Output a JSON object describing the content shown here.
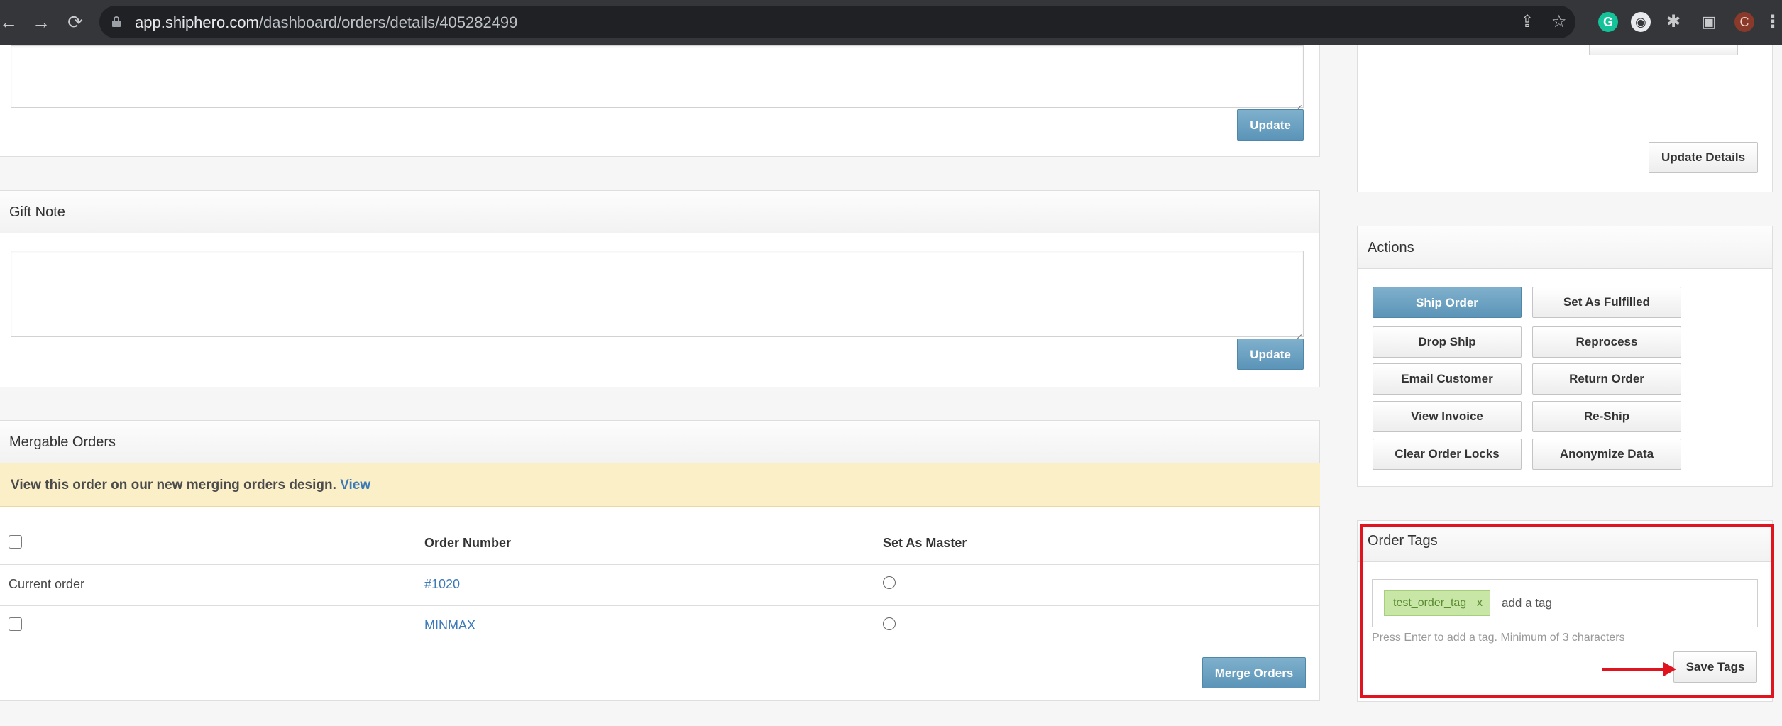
{
  "browser": {
    "url_host": "app.shiphero.com",
    "url_path": "/dashboard/orders/details/405282499",
    "profile_initial": "C",
    "grammarly_initial": "G",
    "accent_color": "#e0141e"
  },
  "notes_panel": {
    "update_label": "Update"
  },
  "gift_note": {
    "title": "Gift Note",
    "update_label": "Update"
  },
  "mergable_orders": {
    "title": "Mergable Orders",
    "notice_text": "View this order on our new merging orders design.",
    "notice_link": "View",
    "columns": [
      "",
      "Order Number",
      "Set As Master"
    ],
    "rows": [
      {
        "label": "Current order",
        "order_number": "#1020"
      },
      {
        "label": "",
        "order_number": "MINMAX"
      }
    ],
    "merge_label": "Merge Orders"
  },
  "details_panel": {
    "update_details_label": "Update Details"
  },
  "actions": {
    "title": "Actions",
    "buttons": [
      "Ship Order",
      "Set As Fulfilled",
      "Drop Ship",
      "Reprocess",
      "Email Customer",
      "Return Order",
      "View Invoice",
      "Re-Ship",
      "Clear Order Locks",
      "Anonymize Data"
    ]
  },
  "order_tags": {
    "title": "Order Tags",
    "tags": [
      "test_order_tag"
    ],
    "tag_remove": "x",
    "input_placeholder": "add a tag",
    "hint": "Press Enter to add a tag. Minimum of 3 characters",
    "save_label": "Save Tags"
  }
}
